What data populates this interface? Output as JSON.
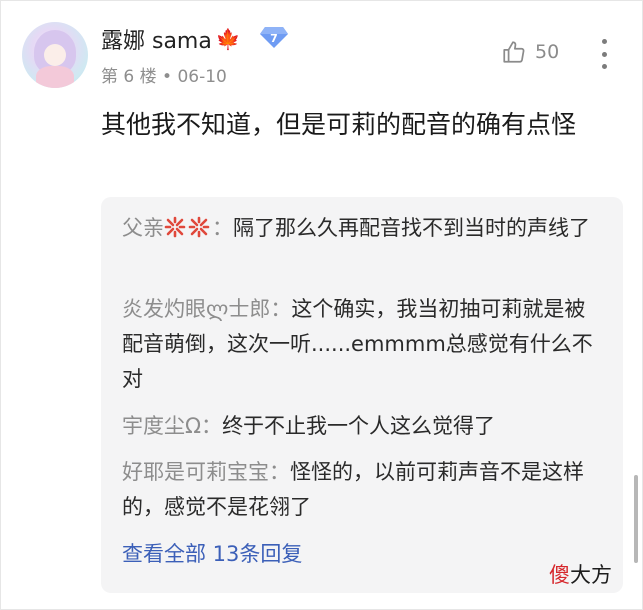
{
  "comment": {
    "username": "露娜 sama",
    "level": "7",
    "floor": "第 6 楼",
    "date": "06-10",
    "likes": "50",
    "content": "其他我不知道，但是可莉的配音的确有点怪"
  },
  "replies": [
    {
      "name": "父亲",
      "text": "隔了那么久再配音找不到当时的声线了"
    },
    {
      "name": "炎发灼眼ლ士郎：",
      "text": "这个确实，我当初抽可莉就是被配音萌倒，这次一听......emmmm总感觉有什么不对"
    },
    {
      "name": "宇度尘Ω：",
      "text": "终于不止我一个人这么觉得了"
    },
    {
      "name": "好耶是可莉宝宝：",
      "text": "怪怪的，以前可莉声音不是这样的，感觉不是花翎了"
    }
  ],
  "view_all": "查看全部 13条回复",
  "watermark": {
    "accent": "傻",
    "rest": "大方"
  },
  "colors": {
    "link": "#3b5fb8",
    "badge": "#6f9cf3",
    "angry": "#e0483b"
  },
  "icons": [
    "maple-leaf-icon",
    "diamond-level-icon",
    "thumbs-up-icon",
    "more-vertical-icon",
    "angry-emoji-icon"
  ]
}
